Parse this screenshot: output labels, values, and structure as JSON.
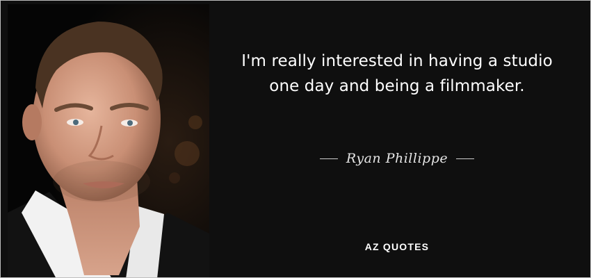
{
  "quote": {
    "text": "I'm really interested in having a studio one day and being a filmmaker.",
    "author": "Ryan Phillippe"
  },
  "brand": {
    "logo_text": "AZ QUOTES"
  },
  "colors": {
    "background": "#0f0f0f",
    "text": "#ffffff",
    "author_text": "#e6e6e6",
    "border": "#bdbdbd"
  }
}
